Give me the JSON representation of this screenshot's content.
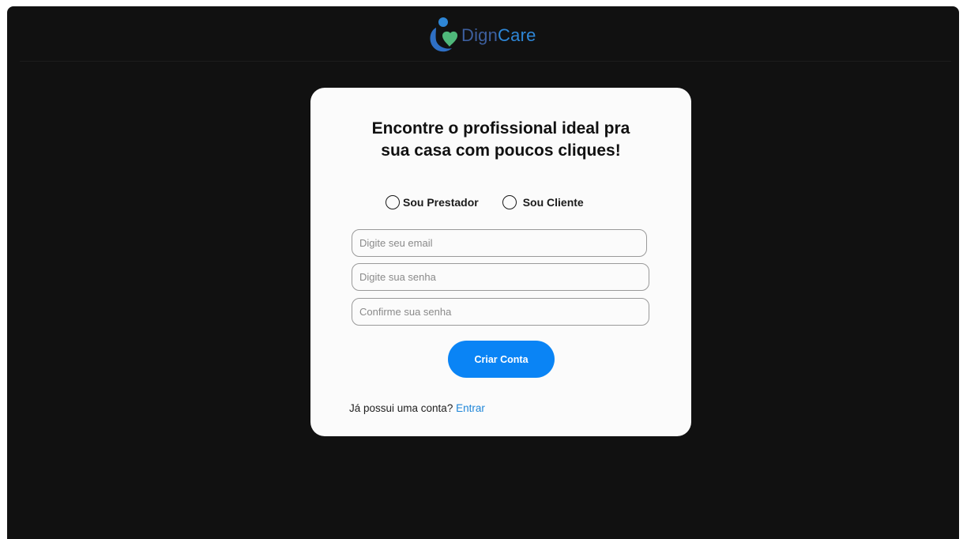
{
  "header": {
    "brand_name_part1": "Dign",
    "brand_name_part2": "Care"
  },
  "signup": {
    "title": "Encontre o profissional ideal pra sua casa com poucos cliques!",
    "roles": [
      {
        "label": "Sou Prestador",
        "selected": false
      },
      {
        "label": "Sou Cliente",
        "selected": false
      }
    ],
    "fields": {
      "email": {
        "value": "",
        "placeholder": "Digite seu email"
      },
      "password": {
        "value": "",
        "placeholder": "Digite sua senha"
      },
      "confirm_password": {
        "value": "",
        "placeholder": "Confirme sua senha"
      }
    },
    "submit_label": "Criar Conta",
    "login_prompt": "Já possui uma conta?",
    "login_link": "Entrar"
  },
  "colors": {
    "background": "#111111",
    "card": "#fbfbfb",
    "primary": "#0a84f5",
    "link": "#1f86d8",
    "logo_green": "#4fb87a",
    "logo_blue": "#2e86d6"
  }
}
